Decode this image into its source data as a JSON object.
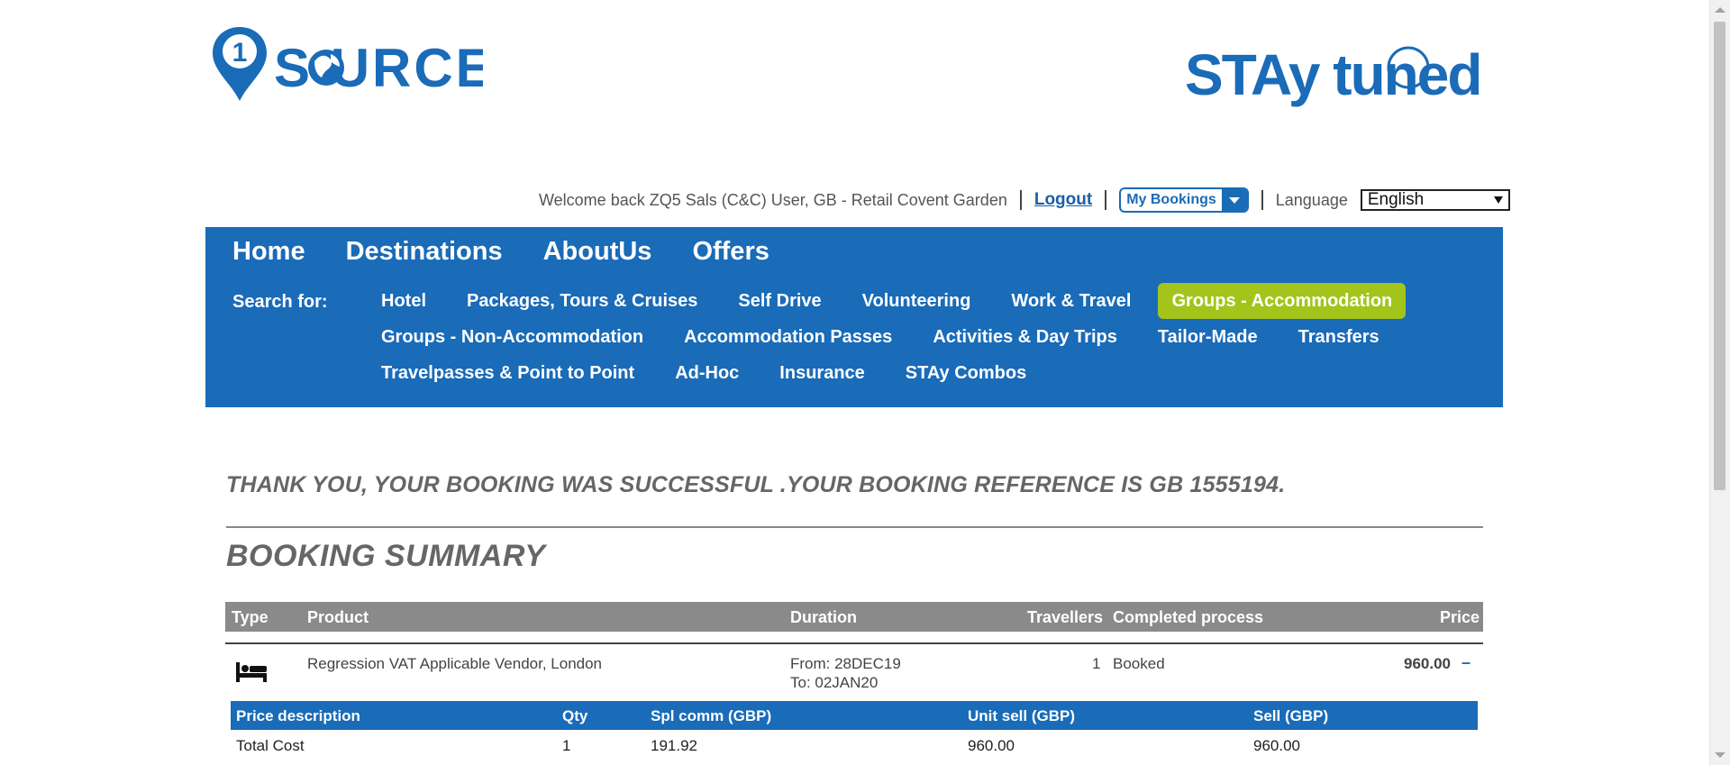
{
  "logos": {
    "left_text": "S URCE",
    "left_number": "1",
    "right_text": "STAy tuned",
    "brand_blue": "#1a6bb8"
  },
  "utility": {
    "welcome": "Welcome back ZQ5 Sals (C&C) User, GB - Retail Covent Garden",
    "logout": "Logout",
    "my_bookings": "My Bookings",
    "language_label": "Language",
    "language_value": "English"
  },
  "nav": {
    "main": [
      "Home",
      "Destinations",
      "AboutUs",
      "Offers"
    ],
    "search_label": "Search for:",
    "rows": [
      [
        {
          "label": "Hotel",
          "active": false
        },
        {
          "label": "Packages, Tours & Cruises",
          "active": false
        },
        {
          "label": "Self Drive",
          "active": false
        },
        {
          "label": "Volunteering",
          "active": false
        },
        {
          "label": "Work & Travel",
          "active": false
        },
        {
          "label": "Groups - Accommodation",
          "active": true
        }
      ],
      [
        {
          "label": "Groups - Non-Accommodation",
          "active": false
        },
        {
          "label": "Accommodation Passes",
          "active": false
        },
        {
          "label": "Activities & Day Trips",
          "active": false
        },
        {
          "label": "Tailor-Made",
          "active": false
        },
        {
          "label": "Transfers",
          "active": false
        }
      ],
      [
        {
          "label": "Travelpasses & Point to Point",
          "active": false
        },
        {
          "label": "Ad-Hoc",
          "active": false
        },
        {
          "label": "Insurance",
          "active": false
        },
        {
          "label": "STAy Combos",
          "active": false
        }
      ]
    ],
    "active_color": "#a3c41a"
  },
  "content": {
    "thanks": "THANK YOU, YOUR BOOKING WAS SUCCESSFUL .YOUR BOOKING REFERENCE IS GB 1555194.",
    "summary_title": "BOOKING SUMMARY"
  },
  "booking_table": {
    "headers": {
      "type": "Type",
      "product": "Product",
      "duration": "Duration",
      "travellers": "Travellers",
      "completed": "Completed process",
      "price": "Price"
    },
    "row": {
      "icon": "bed-icon",
      "product": "Regression VAT Applicable Vendor, London",
      "from": "From: 28DEC19",
      "to": "To: 02JAN20",
      "travellers": "1",
      "completed": "Booked",
      "price": "960.00",
      "toggle": "–"
    }
  },
  "price_table": {
    "headers": {
      "desc": "Price description",
      "qty": "Qty",
      "comm": "Spl comm (GBP)",
      "unit": "Unit sell (GBP)",
      "sell": "Sell (GBP)"
    },
    "row": {
      "desc": "Total Cost",
      "qty": "1",
      "comm": "191.92",
      "unit": "960.00",
      "sell": "960.00"
    }
  }
}
